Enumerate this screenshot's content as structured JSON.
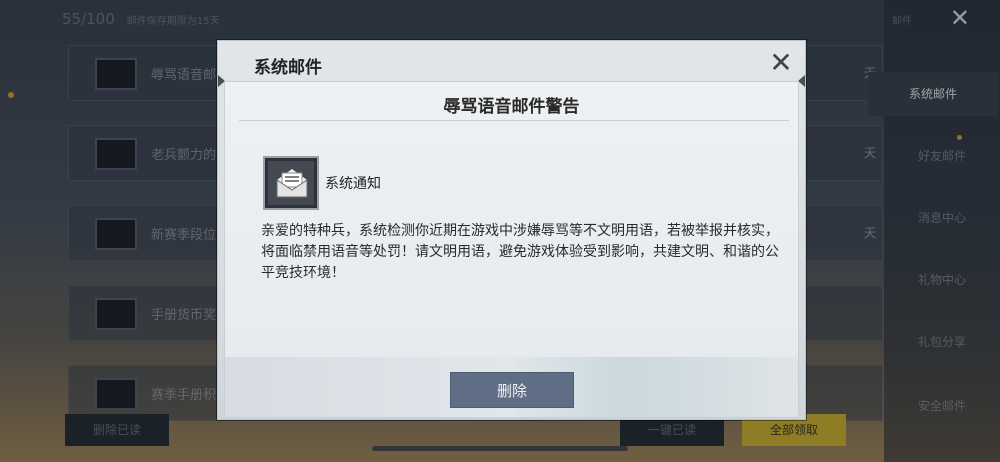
{
  "background": {
    "header_count": "55/100",
    "header_sub": "邮件保存期限为15天",
    "rows": [
      {
        "text": "辱骂语音邮",
        "day": "天"
      },
      {
        "text": "老兵颤力的",
        "day": "天"
      },
      {
        "text": "新赛季段位",
        "day": "天"
      },
      {
        "text": "手册货币奖",
        "day": ""
      },
      {
        "text": "赛季手册积",
        "day": ""
      }
    ],
    "btn_read_delete": "删除已读",
    "btn_all_read": "一键已读",
    "btn_claim_all": "全部领取"
  },
  "sidebar": {
    "top_label": "邮件",
    "items": [
      {
        "label": "系统邮件",
        "active": true
      },
      {
        "label": "好友邮件",
        "active": false
      },
      {
        "label": "消息中心",
        "active": false
      },
      {
        "label": "礼物中心",
        "active": false
      },
      {
        "label": "礼包分享",
        "active": false
      },
      {
        "label": "安全邮件",
        "active": false
      }
    ]
  },
  "modal": {
    "title": "系统邮件",
    "mail_title": "辱骂语音邮件警告",
    "sender": "系统通知",
    "body": "亲爱的特种兵，系统检测你近期在游戏中涉嫌辱骂等不文明用语，若被举报并核实，将面临禁用语音等处罚！请文明用语，避免游戏体验受到影响，共建文明、和谐的公平竞技环境！",
    "delete_label": "删除",
    "close_glyph": "✕"
  },
  "colors": {
    "accent_yellow": "#d8b830",
    "delete_button": "#5f6e84"
  }
}
